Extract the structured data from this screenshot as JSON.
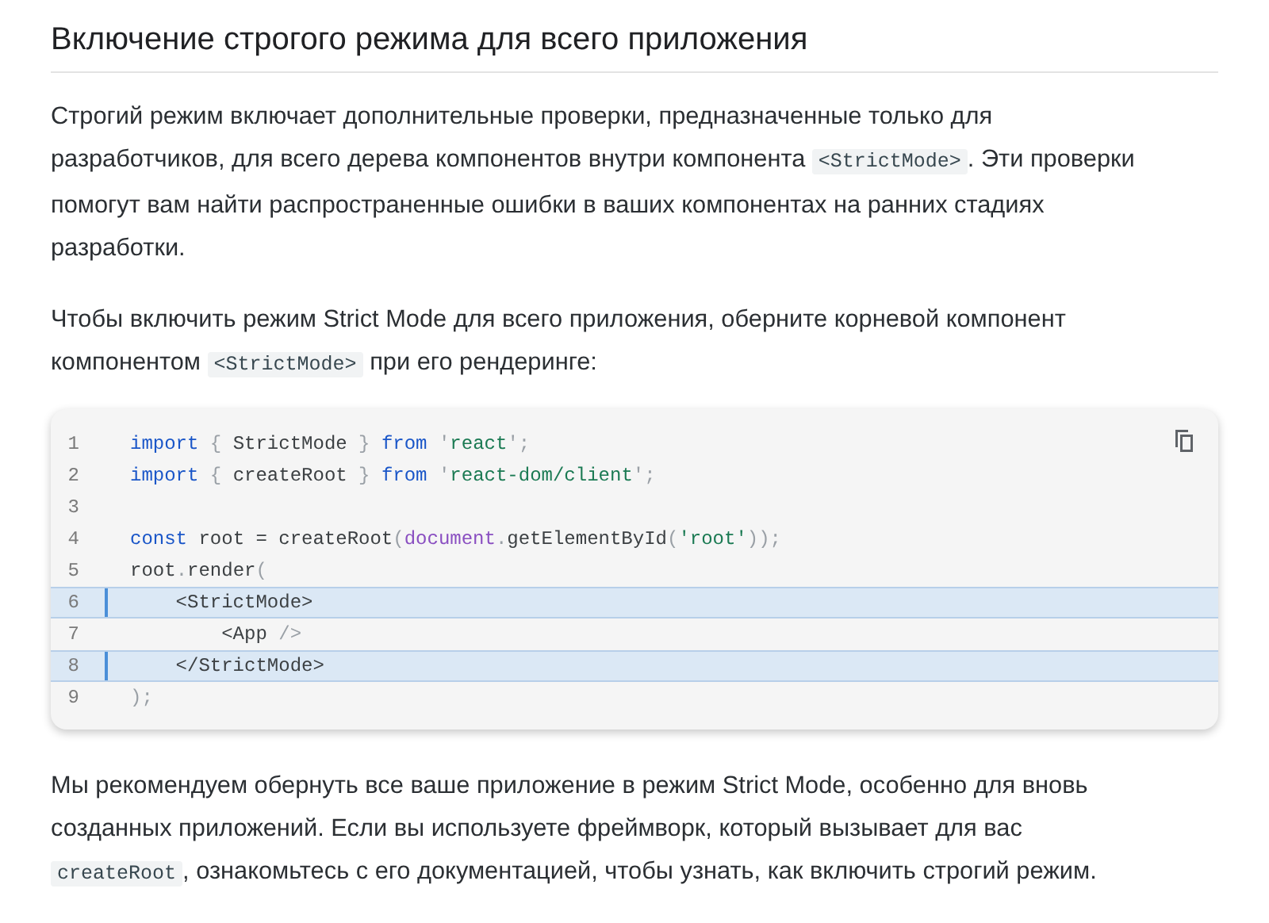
{
  "heading": "Включение строгого режима для всего приложения",
  "paragraphs_before": [
    [
      {
        "kind": "text",
        "text": "Строгий режим включает дополнительные проверки, предназначенные только для разработчиков, для всего дерева компонентов внутри компонента "
      },
      {
        "kind": "code",
        "text": "<StrictMode>"
      },
      {
        "kind": "text",
        "text": ". Эти проверки помогут вам найти распространенные ошибки в ваших компонентах на ранних стадиях разработки."
      }
    ],
    [
      {
        "kind": "text",
        "text": "Чтобы включить режим Strict Mode для всего приложения, оберните корневой компонент компонентом "
      },
      {
        "kind": "code",
        "text": "<StrictMode>"
      },
      {
        "kind": "text",
        "text": " при его рендеринге:"
      }
    ]
  ],
  "code_block": {
    "lines": [
      {
        "number": "1",
        "highlighted": false,
        "tokens": [
          {
            "kind": "keyword",
            "text": "import"
          },
          {
            "kind": "punct",
            "text": " { "
          },
          {
            "kind": "plain",
            "text": "StrictMode"
          },
          {
            "kind": "punct",
            "text": " } "
          },
          {
            "kind": "keyword",
            "text": "from"
          },
          {
            "kind": "punct",
            "text": " '"
          },
          {
            "kind": "string",
            "text": "react"
          },
          {
            "kind": "punct",
            "text": "';"
          }
        ]
      },
      {
        "number": "2",
        "highlighted": false,
        "tokens": [
          {
            "kind": "keyword",
            "text": "import"
          },
          {
            "kind": "punct",
            "text": " { "
          },
          {
            "kind": "plain",
            "text": "createRoot"
          },
          {
            "kind": "punct",
            "text": " } "
          },
          {
            "kind": "keyword",
            "text": "from"
          },
          {
            "kind": "punct",
            "text": " '"
          },
          {
            "kind": "string",
            "text": "react-dom/client"
          },
          {
            "kind": "punct",
            "text": "';"
          }
        ]
      },
      {
        "number": "3",
        "highlighted": false
      },
      {
        "number": "4",
        "highlighted": false,
        "tokens": [
          {
            "kind": "keyword",
            "text": "const"
          },
          {
            "kind": "plain",
            "text": " root = createRoot"
          },
          {
            "kind": "punct",
            "text": "("
          },
          {
            "kind": "variable",
            "text": "document"
          },
          {
            "kind": "punct",
            "text": "."
          },
          {
            "kind": "plain",
            "text": "getElementById"
          },
          {
            "kind": "punct",
            "text": "("
          },
          {
            "kind": "string",
            "text": "'root'"
          },
          {
            "kind": "punct",
            "text": "));"
          }
        ]
      },
      {
        "number": "5",
        "highlighted": false,
        "tokens": [
          {
            "kind": "plain",
            "text": "root"
          },
          {
            "kind": "punct",
            "text": "."
          },
          {
            "kind": "plain",
            "text": "render"
          },
          {
            "kind": "punct",
            "text": "("
          }
        ]
      },
      {
        "number": "6",
        "highlighted": true,
        "tokens": [
          {
            "kind": "plain",
            "text": "    <StrictMode>"
          }
        ]
      },
      {
        "number": "7",
        "highlighted": false,
        "tokens": [
          {
            "kind": "plain",
            "text": "        <App "
          },
          {
            "kind": "punct",
            "text": "/>"
          }
        ]
      },
      {
        "number": "8",
        "highlighted": true,
        "tokens": [
          {
            "kind": "plain",
            "text": "    </StrictMode>"
          }
        ]
      },
      {
        "number": "9",
        "highlighted": false,
        "tokens": [
          {
            "kind": "punct",
            "text": ");"
          }
        ]
      }
    ]
  },
  "paragraphs_after": [
    [
      {
        "kind": "text",
        "text": "Мы рекомендуем обернуть все ваше приложение в режим Strict Mode, особенно для вновь созданных приложений. Если вы используете фреймворк, который вызывает для вас "
      },
      {
        "kind": "code",
        "text": "createRoot"
      },
      {
        "kind": "text",
        "text": ", ознакомьтесь с его документацией, чтобы узнать, как включить строгий режим."
      }
    ]
  ]
}
